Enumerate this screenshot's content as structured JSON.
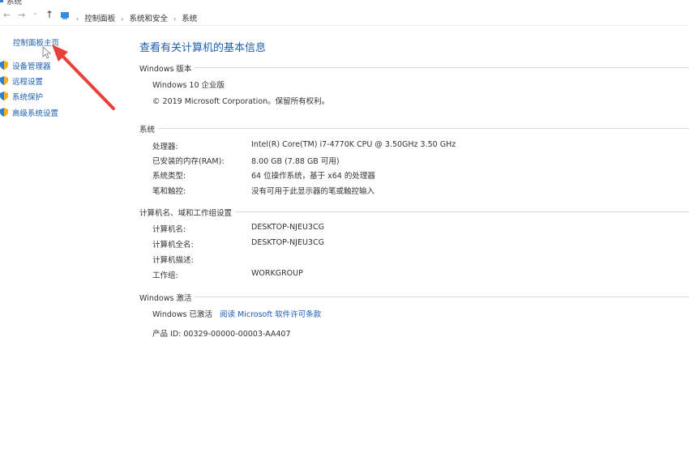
{
  "window": {
    "title": "系统"
  },
  "address_bar": {
    "back_icon": "arrow-left-icon",
    "forward_icon": "arrow-right-icon",
    "up_icon": "arrow-up-icon",
    "breadcrumbs": [
      "控制面板",
      "系统和安全",
      "系统"
    ]
  },
  "sidebar": {
    "home": "控制面板主页",
    "items": [
      {
        "label": "设备管理器",
        "icon": "shield-icon"
      },
      {
        "label": "远程设置",
        "icon": "shield-icon"
      },
      {
        "label": "系统保护",
        "icon": "shield-icon"
      },
      {
        "label": "高级系统设置",
        "icon": "shield-icon"
      }
    ]
  },
  "main": {
    "title": "查看有关计算机的基本信息",
    "edition_section": {
      "heading": "Windows 版本",
      "edition": "Windows 10 企业版",
      "copyright": "© 2019 Microsoft Corporation。保留所有权利。"
    },
    "system_section": {
      "heading": "系统",
      "rows": [
        {
          "label": "处理器:",
          "value": "Intel(R) Core(TM) i7-4770K CPU @ 3.50GHz   3.50 GHz"
        },
        {
          "label": "已安装的内存(RAM):",
          "value": "8.00 GB (7.88 GB 可用)"
        },
        {
          "label": "系统类型:",
          "value": "64 位操作系统，基于 x64 的处理器"
        },
        {
          "label": "笔和触控:",
          "value": "没有可用于此显示器的笔或触控输入"
        }
      ]
    },
    "computer_section": {
      "heading": "计算机名、域和工作组设置",
      "rows": [
        {
          "label": "计算机名:",
          "value": "DESKTOP-NJEU3CG"
        },
        {
          "label": "计算机全名:",
          "value": "DESKTOP-NJEU3CG"
        },
        {
          "label": "计算机描述:",
          "value": ""
        },
        {
          "label": "工作组:",
          "value": "WORKGROUP"
        }
      ]
    },
    "activation_section": {
      "heading": "Windows 激活",
      "status": "Windows 已激活",
      "license_link": "阅读 Microsoft 软件许可条款",
      "product_id": "产品 ID: 00329-00000-00003-AA407"
    }
  },
  "colors": {
    "link": "#1a5fb4",
    "arrow": "#e8413a",
    "divider": "#d9d9d9"
  }
}
